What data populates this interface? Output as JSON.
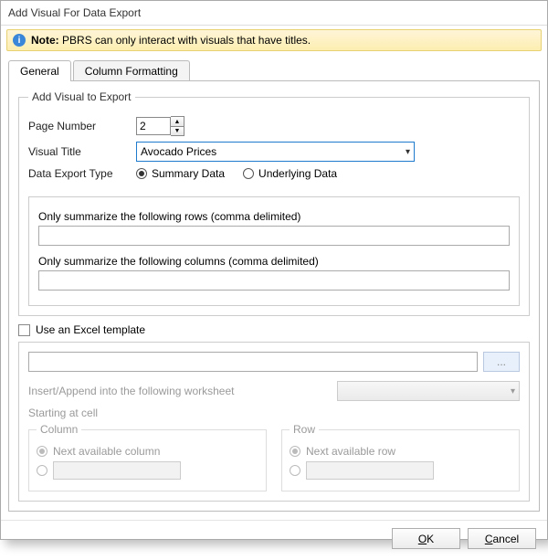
{
  "window": {
    "title": "Add Visual For Data Export"
  },
  "note": {
    "label": "Note:",
    "text": "PBRS can only interact with visuals that have titles."
  },
  "tabs": {
    "general": "General",
    "column_formatting": "Column Formatting"
  },
  "group": {
    "legend": "Add Visual to Export",
    "page_number_label": "Page Number",
    "page_number_value": "2",
    "visual_title_label": "Visual Title",
    "visual_title_value": "Avocado Prices",
    "data_export_type_label": "Data Export Type",
    "summary_data": "Summary Data",
    "underlying_data": "Underlying Data",
    "rows_label": "Only summarize the following rows (comma delimited)",
    "cols_label": "Only summarize the following columns (comma delimited)"
  },
  "template": {
    "use_label": "Use an Excel template",
    "browse": "...",
    "insert_append": "Insert/Append into the following worksheet",
    "starting_at": "Starting at cell",
    "column_legend": "Column",
    "row_legend": "Row",
    "next_col": "Next available column",
    "next_row": "Next available row"
  },
  "buttons": {
    "ok": "OK",
    "cancel": "Cancel"
  }
}
